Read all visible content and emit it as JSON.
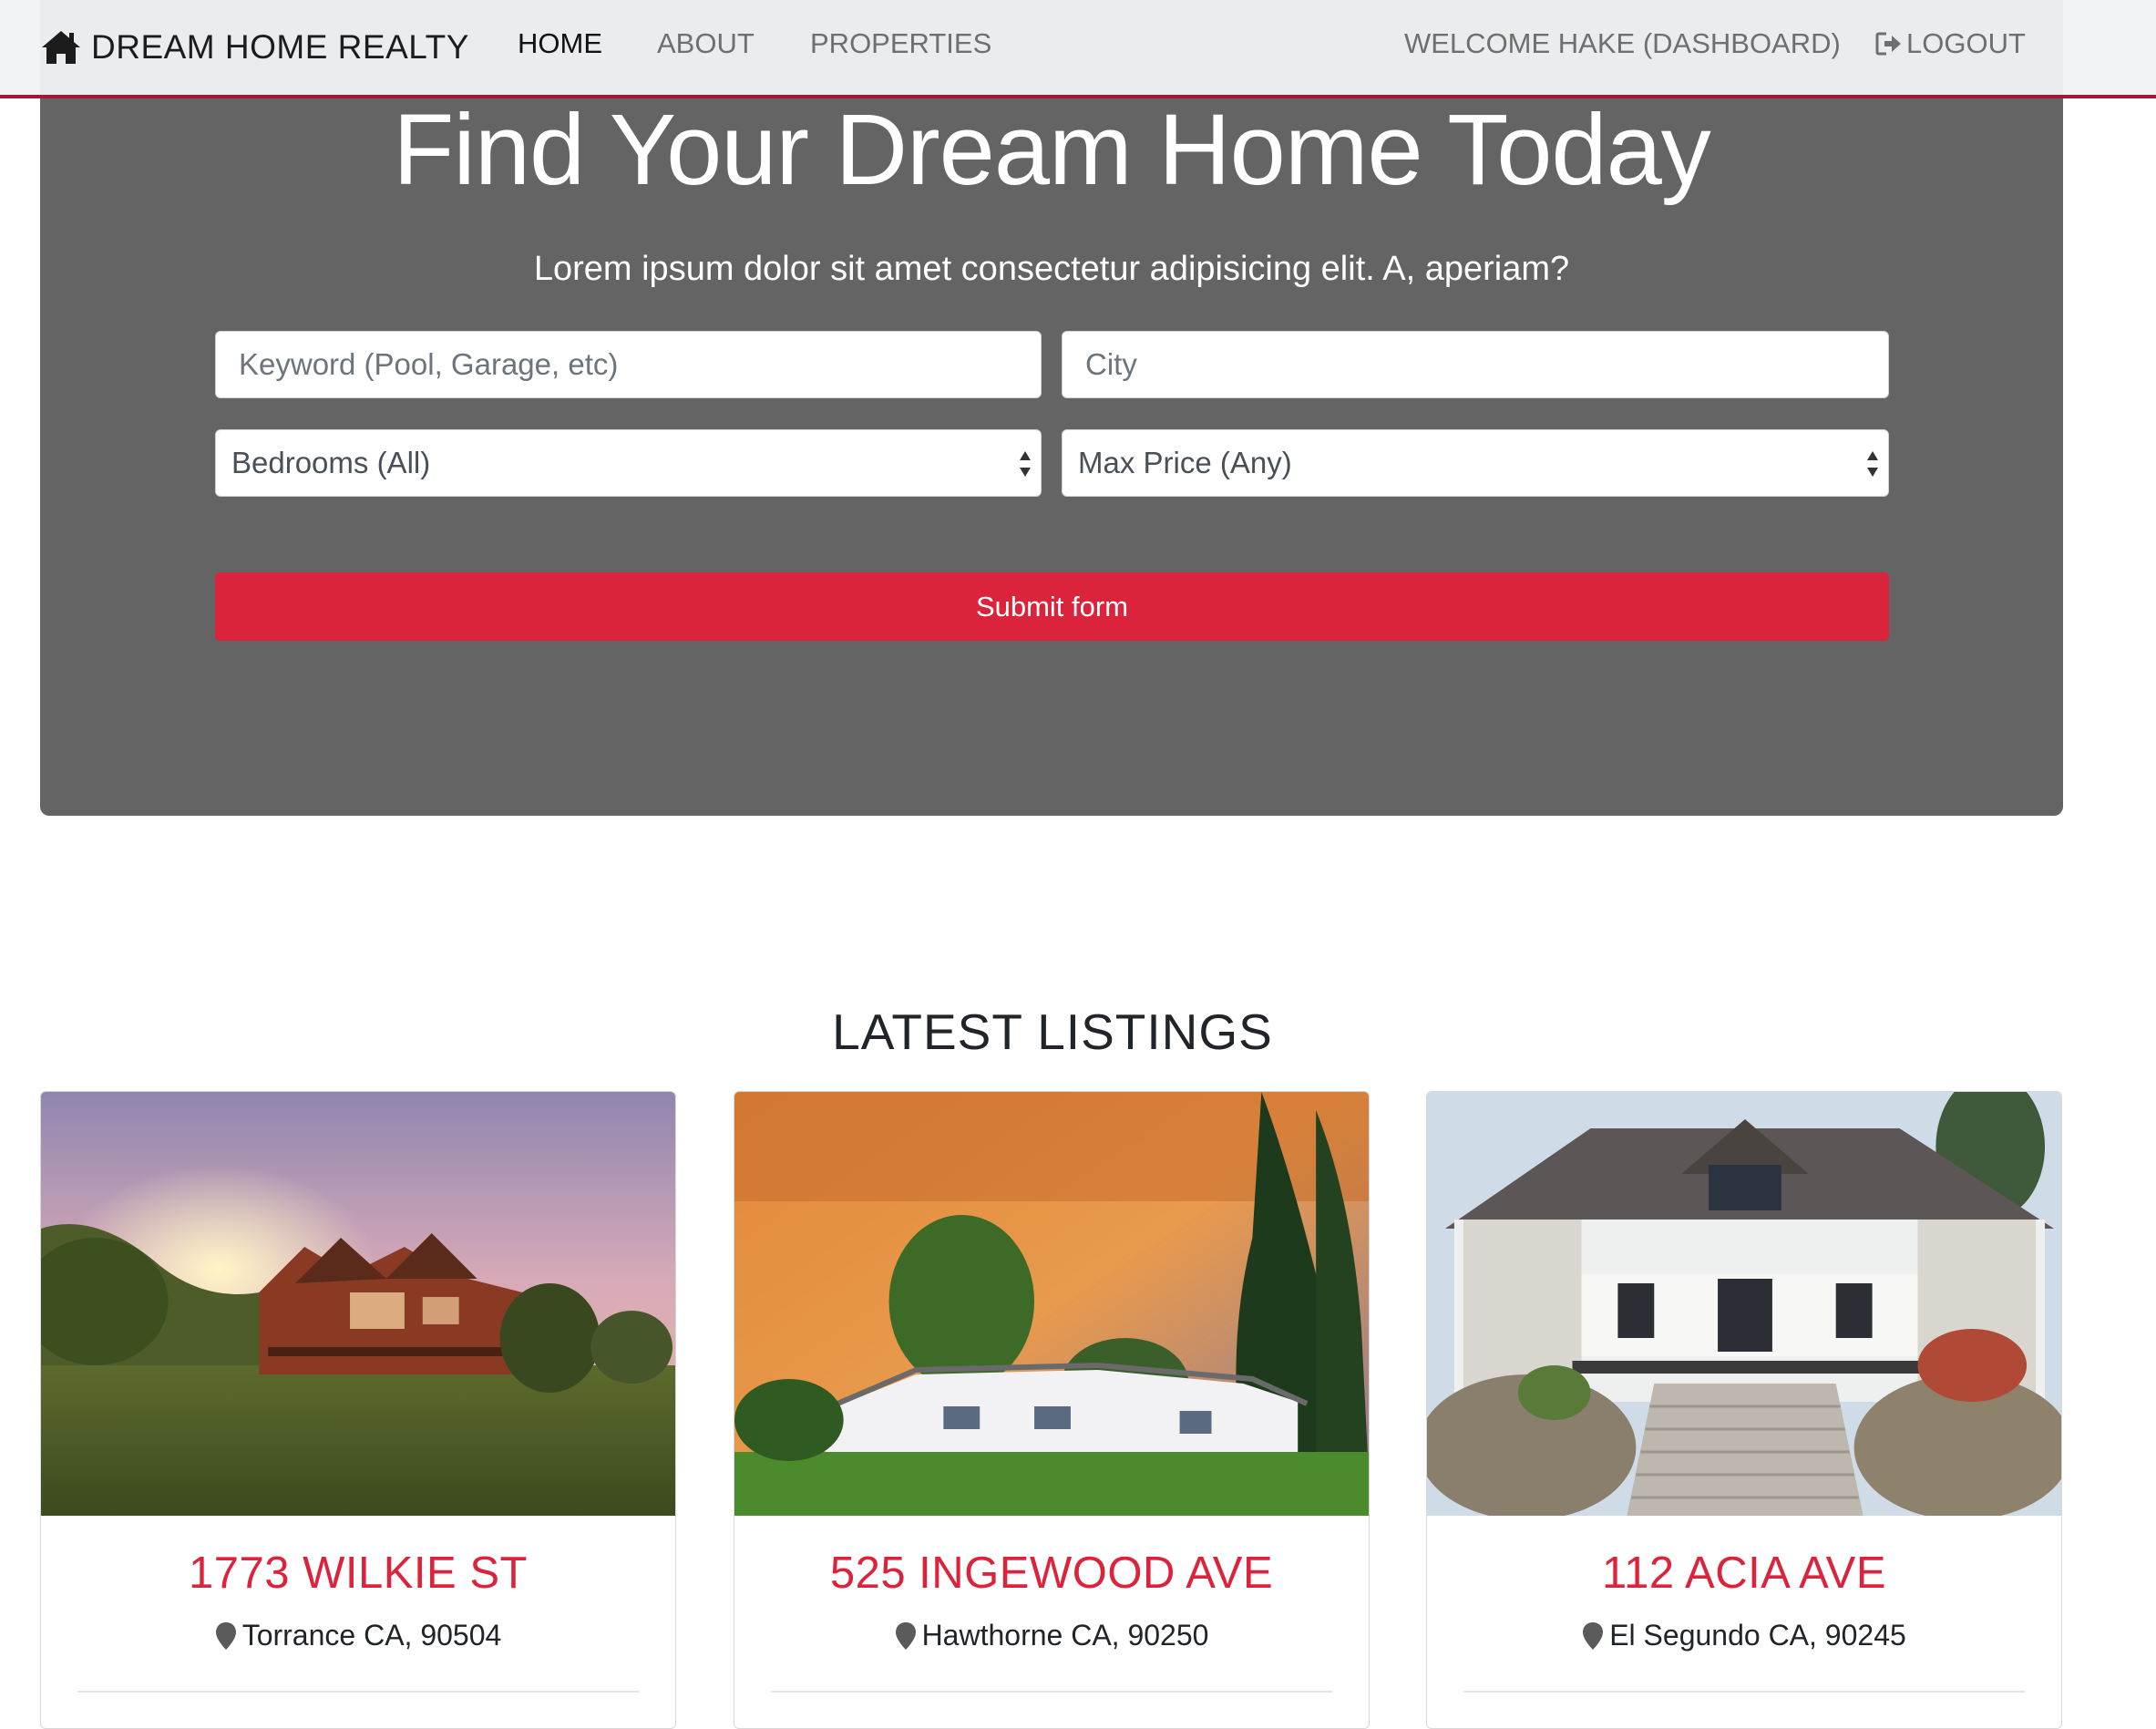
{
  "navbar": {
    "brand": "DREAM HOME REALTY",
    "links": [
      "HOME",
      "ABOUT",
      "PROPERTIES"
    ],
    "welcome": "WELCOME HAKE (DASHBOARD)",
    "logout": "LOGOUT"
  },
  "hero": {
    "title": "Find Your Dream Home Today",
    "lead": "Lorem ipsum dolor sit amet consectetur adipisicing elit. A, aperiam?",
    "keyword_placeholder": "Keyword (Pool, Garage, etc)",
    "city_placeholder": "City",
    "bedrooms_selected": "Bedrooms (All)",
    "price_selected": "Max Price (Any)",
    "submit_label": "Submit form"
  },
  "listings": {
    "title": "LATEST LISTINGS",
    "items": [
      {
        "title": "1773 WILKIE ST",
        "location": "Torrance CA, 90504"
      },
      {
        "title": "525 INGEWOOD AVE",
        "location": "Hawthorne CA, 90250"
      },
      {
        "title": "112 ACIA AVE",
        "location": "El Segundo CA, 90245"
      }
    ]
  },
  "colors": {
    "accent": "#dc233c",
    "hero_bg": "#646464",
    "nav_border": "#a5163c"
  }
}
